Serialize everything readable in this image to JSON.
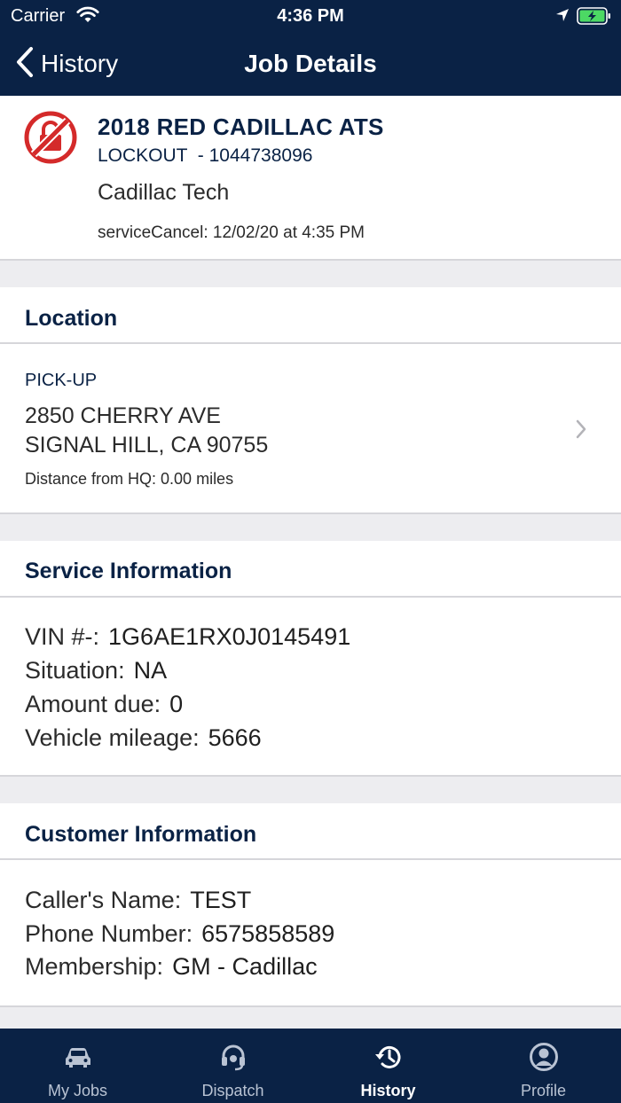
{
  "status_bar": {
    "carrier": "Carrier",
    "time": "4:36 PM"
  },
  "nav": {
    "back_label": "History",
    "title": "Job Details"
  },
  "job": {
    "vehicle": "2018 RED CADILLAC ATS",
    "type_line": "LOCKOUT  - 1044738096",
    "company": "Cadillac Tech",
    "cancel_line": "serviceCancel: 12/02/20 at 4:35 PM",
    "status_icon": "lock-cancelled-icon",
    "status_color": "#d42a2a"
  },
  "location": {
    "heading": "Location",
    "pickup_label": "PICK-UP",
    "address_line1": "2850 CHERRY AVE",
    "address_line2": "SIGNAL HILL, CA 90755",
    "distance": "Distance from HQ: 0.00 miles"
  },
  "service": {
    "heading": "Service Information",
    "rows": [
      {
        "label": "VIN #-:",
        "value": "1G6AE1RX0J0145491"
      },
      {
        "label": "Situation:",
        "value": "NA"
      },
      {
        "label": "Amount due:",
        "value": "0"
      },
      {
        "label": "Vehicle mileage:",
        "value": "5666"
      }
    ]
  },
  "customer": {
    "heading": "Customer Information",
    "rows": [
      {
        "label": "Caller's Name:",
        "value": "TEST"
      },
      {
        "label": "Phone Number:",
        "value": "6575858589"
      },
      {
        "label": "Membership:",
        "value": "GM - Cadillac"
      }
    ]
  },
  "tabs": [
    {
      "label": "My Jobs",
      "icon": "car-icon",
      "active": false
    },
    {
      "label": "Dispatch",
      "icon": "headset-icon",
      "active": false
    },
    {
      "label": "History",
      "icon": "history-icon",
      "active": true
    },
    {
      "label": "Profile",
      "icon": "profile-icon",
      "active": false
    }
  ],
  "colors": {
    "navy": "#0a2245",
    "background": "#ededf0",
    "battery": "#4cd964"
  }
}
